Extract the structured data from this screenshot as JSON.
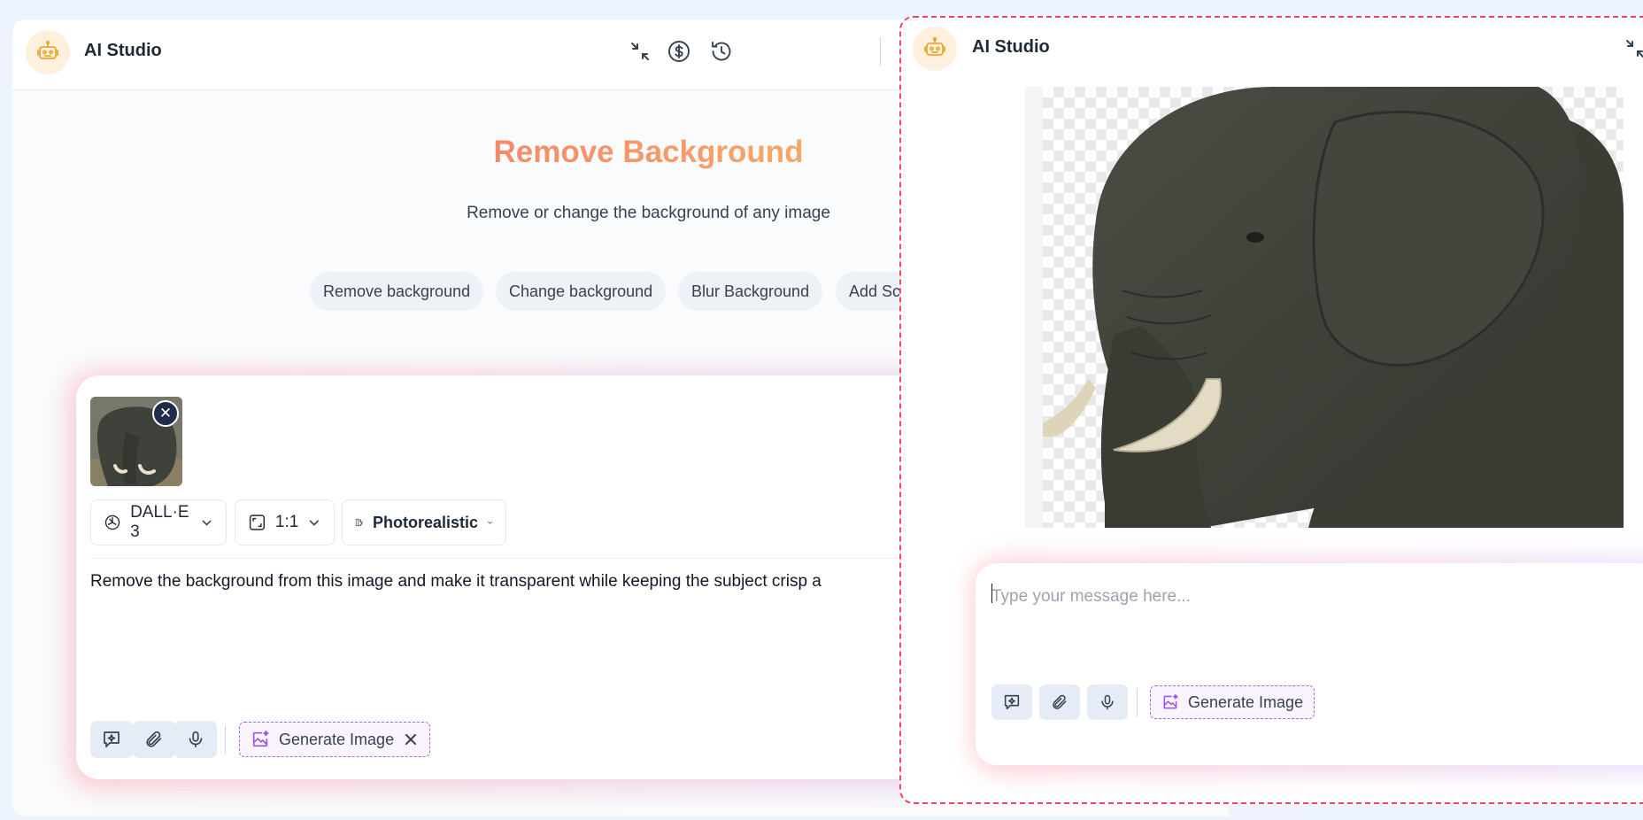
{
  "left": {
    "app_title": "AI Studio",
    "page_title": "Remove Background",
    "page_subtitle": "Remove or change the background of any image",
    "chips": [
      "Remove background",
      "Change background",
      "Blur Background",
      "Add Sc"
    ],
    "composer": {
      "model": "DALL·E 3",
      "ratio": "1:1",
      "style": "Photorealistic",
      "prompt": "Remove the background from this image and make it transparent while keeping the subject crisp a",
      "generate_label": "Generate Image"
    }
  },
  "right": {
    "app_title": "AI Studio",
    "input_placeholder": "Type your message here...",
    "generate_label": "Generate Image"
  },
  "icons": {
    "logo": "robot-icon",
    "header": [
      "collapse-icon",
      "dollar-coin-icon",
      "history-icon"
    ],
    "tools": [
      "prompt-enhance-icon",
      "paperclip-icon",
      "microphone-icon",
      "image-sparkle-icon"
    ]
  },
  "colors": {
    "title_gradient_start": "#f15b6e",
    "title_gradient_end": "#f9b56b",
    "generate_border": "#a768ef",
    "right_panel_border": "#ef4560",
    "tool_bg": "#e6ecf5"
  }
}
